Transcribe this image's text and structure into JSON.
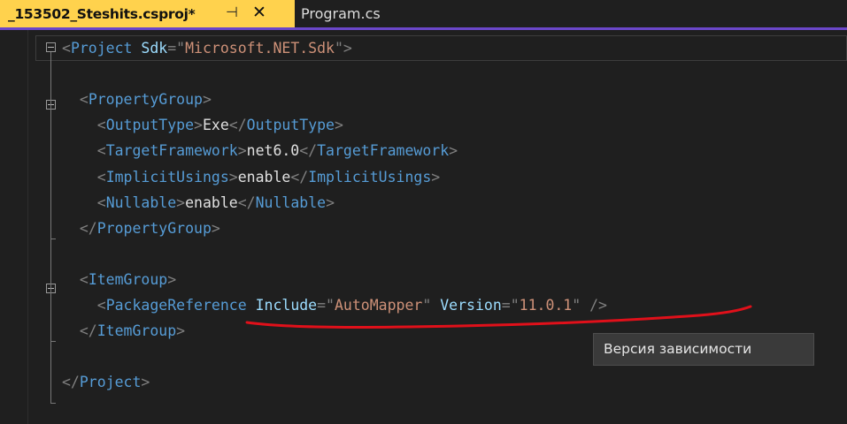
{
  "tabs": [
    {
      "label": "_153502_Steshits.csproj*",
      "pin_icon": "⊣",
      "close_icon": "✕"
    },
    {
      "label": "Program.cs"
    }
  ],
  "code_lines": [
    [
      [
        "p",
        "<"
      ],
      [
        "t",
        "Project"
      ],
      [
        "x",
        " "
      ],
      [
        "a",
        "Sdk"
      ],
      [
        "p",
        "=\""
      ],
      [
        "v",
        "Microsoft.NET.Sdk"
      ],
      [
        "p",
        "\">"
      ]
    ],
    [],
    [
      [
        "x",
        "  "
      ],
      [
        "p",
        "<"
      ],
      [
        "t",
        "PropertyGroup"
      ],
      [
        "p",
        ">"
      ]
    ],
    [
      [
        "x",
        "    "
      ],
      [
        "p",
        "<"
      ],
      [
        "t",
        "OutputType"
      ],
      [
        "p",
        ">"
      ],
      [
        "x",
        "Exe"
      ],
      [
        "p",
        "</"
      ],
      [
        "t",
        "OutputType"
      ],
      [
        "p",
        ">"
      ]
    ],
    [
      [
        "x",
        "    "
      ],
      [
        "p",
        "<"
      ],
      [
        "t",
        "TargetFramework"
      ],
      [
        "p",
        ">"
      ],
      [
        "x",
        "net6.0"
      ],
      [
        "p",
        "</"
      ],
      [
        "t",
        "TargetFramework"
      ],
      [
        "p",
        ">"
      ]
    ],
    [
      [
        "x",
        "    "
      ],
      [
        "p",
        "<"
      ],
      [
        "t",
        "ImplicitUsings"
      ],
      [
        "p",
        ">"
      ],
      [
        "x",
        "enable"
      ],
      [
        "p",
        "</"
      ],
      [
        "t",
        "ImplicitUsings"
      ],
      [
        "p",
        ">"
      ]
    ],
    [
      [
        "x",
        "    "
      ],
      [
        "p",
        "<"
      ],
      [
        "t",
        "Nullable"
      ],
      [
        "p",
        ">"
      ],
      [
        "x",
        "enable"
      ],
      [
        "p",
        "</"
      ],
      [
        "t",
        "Nullable"
      ],
      [
        "p",
        ">"
      ]
    ],
    [
      [
        "x",
        "  "
      ],
      [
        "p",
        "</"
      ],
      [
        "t",
        "PropertyGroup"
      ],
      [
        "p",
        ">"
      ]
    ],
    [],
    [
      [
        "x",
        "  "
      ],
      [
        "p",
        "<"
      ],
      [
        "t",
        "ItemGroup"
      ],
      [
        "p",
        ">"
      ]
    ],
    [
      [
        "x",
        "    "
      ],
      [
        "p",
        "<"
      ],
      [
        "t",
        "PackageReference"
      ],
      [
        "x",
        " "
      ],
      [
        "a",
        "Include"
      ],
      [
        "p",
        "=\""
      ],
      [
        "v",
        "AutoMapper"
      ],
      [
        "p",
        "\""
      ],
      [
        "x",
        " "
      ],
      [
        "a",
        "Version"
      ],
      [
        "p",
        "=\""
      ],
      [
        "v",
        "11.0.1"
      ],
      [
        "p",
        "\""
      ],
      [
        "x",
        " "
      ],
      [
        "p",
        "/>"
      ]
    ],
    [
      [
        "x",
        "  "
      ],
      [
        "p",
        "</"
      ],
      [
        "t",
        "ItemGroup"
      ],
      [
        "p",
        ">"
      ]
    ],
    [],
    [
      [
        "p",
        "</"
      ],
      [
        "t",
        "Project"
      ],
      [
        "p",
        ">"
      ]
    ]
  ],
  "tooltip": {
    "text": "Версия зависимости"
  },
  "colors": {
    "active_tab": "#ffd24d",
    "accent_underline": "#6b47c9",
    "editor_bg": "#1f1f1f",
    "tag": "#569cd6",
    "attribute": "#9cdcfe",
    "string": "#ce9178",
    "punctuation": "#808080",
    "text": "#e0e0e0",
    "annotation": "#e0101a"
  }
}
